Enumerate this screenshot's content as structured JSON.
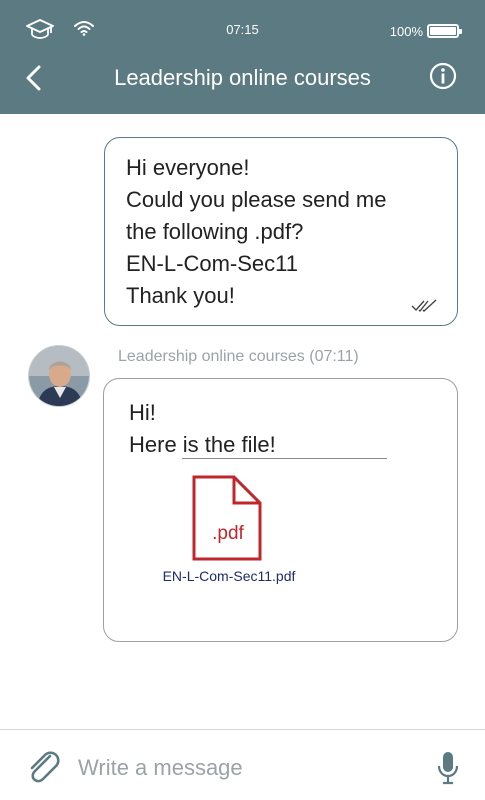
{
  "status_bar": {
    "time": "07:15",
    "battery": "100%",
    "icons": [
      "graduation-cap-icon",
      "wifi-icon",
      "battery-icon"
    ]
  },
  "header": {
    "title": "Leadership online courses",
    "back_icon": "chevron-left-icon",
    "info_icon": "info-icon"
  },
  "messages": {
    "sent": {
      "lines": [
        "Hi everyone!",
        "Could you please send me",
        "the following .pdf?",
        "EN-L-Com-Sec11",
        "Thank you!"
      ],
      "status_icon": "double-check-icon"
    },
    "received": {
      "sender": "Leadership online courses (07:11)",
      "lines": [
        "Hi!",
        "Here is the file!"
      ],
      "attachment": {
        "icon_label": ".pdf",
        "file_name": "EN-L-Com-Sec11.pdf"
      }
    }
  },
  "composer": {
    "placeholder": "Write a message",
    "attach_icon": "paperclip-icon",
    "mic_icon": "microphone-icon"
  },
  "colors": {
    "header_bg": "#5b7a82",
    "pdf_red": "#c0272d",
    "file_link": "#1f2b6b"
  }
}
